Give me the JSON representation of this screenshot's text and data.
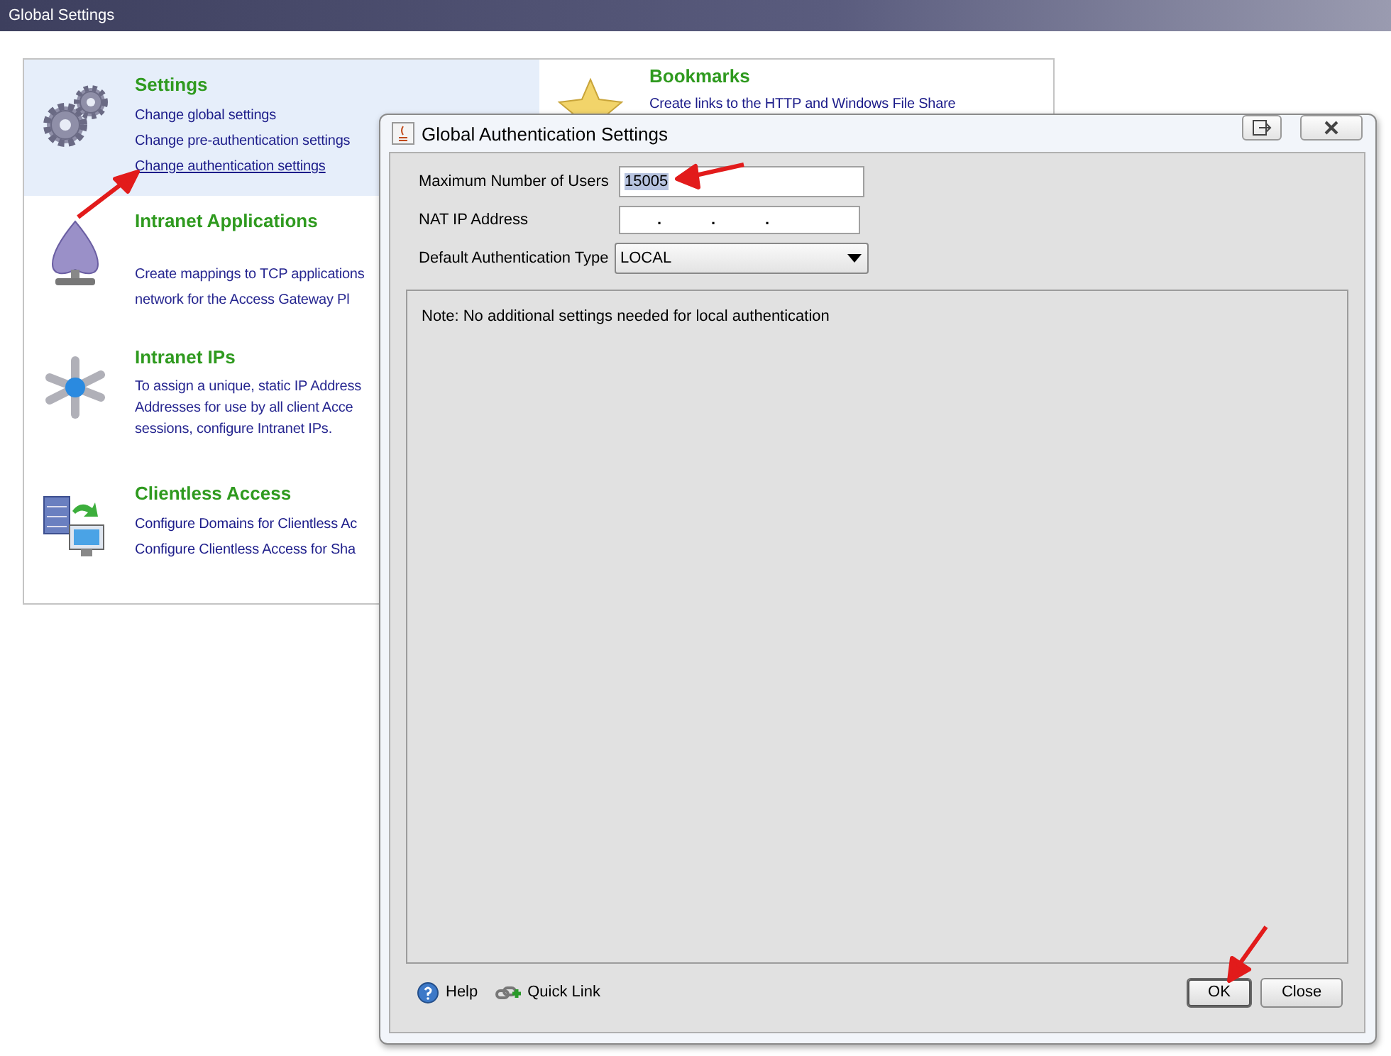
{
  "window": {
    "title": "Global Settings"
  },
  "left_sections": [
    {
      "title": "Settings",
      "selected": true,
      "lines": [
        {
          "text": "Change global settings",
          "kind": "link",
          "hovered": false
        },
        {
          "text": "Change pre-authentication settings",
          "kind": "link",
          "hovered": false
        },
        {
          "text": "Change authentication settings",
          "kind": "link",
          "hovered": true
        }
      ]
    },
    {
      "title": "Intranet Applications",
      "selected": false,
      "lines": [
        {
          "text": "Create mappings to TCP applications",
          "kind": "text",
          "hovered": false
        },
        {
          "text": "network for the Access Gateway Pl",
          "kind": "text",
          "hovered": false
        }
      ]
    },
    {
      "title": "Intranet IPs",
      "selected": false,
      "lines": [
        {
          "text": "To assign a unique, static IP Address",
          "kind": "text",
          "hovered": false
        },
        {
          "text": "Addresses for use by all client Acce",
          "kind": "text",
          "hovered": false
        },
        {
          "text": "sessions, configure Intranet IPs.",
          "kind": "text",
          "hovered": false
        }
      ]
    },
    {
      "title": "Clientless Access",
      "selected": false,
      "lines": [
        {
          "text": "Configure Domains for Clientless Ac",
          "kind": "link",
          "hovered": false
        },
        {
          "text": "Configure Clientless Access for Sha",
          "kind": "link",
          "hovered": false
        }
      ]
    }
  ],
  "right_sections": [
    {
      "title": "Bookmarks",
      "selected": false,
      "lines": [
        {
          "text": "Create links to the HTTP and Windows File Share",
          "kind": "link",
          "hovered": false
        }
      ]
    }
  ],
  "dialog": {
    "title": "Global Authentication Settings",
    "fields": [
      {
        "kind": "text",
        "label": "Maximum Number of Users",
        "value": "15005",
        "value_selected": true
      },
      {
        "kind": "ip",
        "label": "NAT IP Address",
        "separators": [
          ".",
          ".",
          "."
        ]
      },
      {
        "kind": "dropdown",
        "label": "Default Authentication Type",
        "value": "LOCAL"
      }
    ],
    "note": "Note: No additional settings needed for local authentication",
    "footer_links": [
      "Help",
      "Quick Link"
    ],
    "buttons": [
      {
        "text": "OK",
        "default": true
      },
      {
        "text": "Close",
        "default": false
      }
    ]
  }
}
